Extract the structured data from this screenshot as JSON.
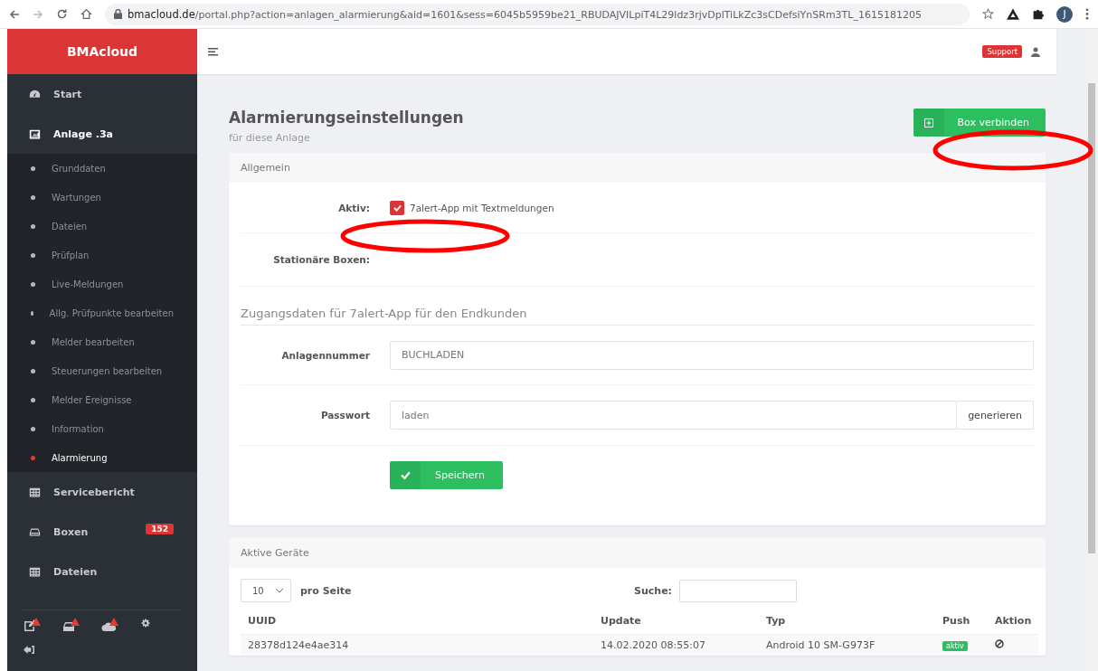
{
  "browser": {
    "domain": "bmacloud.de",
    "path": "/portal.php?action=anlagen_alarmierung&aid=1601&sess=6045b5959be21_RBUDAJVILpiT4L29ldz3rjvDplTiLkZc3sCDefsiYnSRm3TL_1615181205",
    "profile": "J"
  },
  "sidebar": {
    "brand": "BMAcloud",
    "items": [
      {
        "label": "Start",
        "selected": false
      },
      {
        "label": "Anlage .3a",
        "selected": true,
        "children": [
          {
            "label": "Grunddaten",
            "selected": false
          },
          {
            "label": "Wartungen",
            "selected": false
          },
          {
            "label": "Dateien",
            "selected": false
          },
          {
            "label": "Prüfplan",
            "selected": false
          },
          {
            "label": "Live-Meldungen",
            "selected": false
          },
          {
            "label": "Allg. Prüfpunkte bearbeiten",
            "selected": false
          },
          {
            "label": "Melder bearbeiten",
            "selected": false
          },
          {
            "label": "Steuerungen bearbeiten",
            "selected": false
          },
          {
            "label": "Melder Ereignisse",
            "selected": false
          },
          {
            "label": "Information",
            "selected": false
          },
          {
            "label": "Alarmierung",
            "selected": true
          }
        ]
      },
      {
        "label": "Servicebericht",
        "selected": false
      },
      {
        "label": "Boxen",
        "selected": false,
        "badge": "152"
      },
      {
        "label": "Dateien",
        "selected": false
      }
    ]
  },
  "header": {
    "support": "Support"
  },
  "page": {
    "title": "Alarmierungseinstellungen",
    "subtitle": "für diese Anlage",
    "connect_button": "Box verbinden"
  },
  "general": {
    "header": "Allgemein",
    "active_label": "Aktiv:",
    "active_option": "7alert-App mit Textmeldungen",
    "active_checked": true,
    "stationary_label": "Stationäre Boxen:",
    "section_title": "Zugangsdaten für 7alert-App für den Endkunden",
    "fields": [
      {
        "label": "Anlagennummer",
        "value": "BUCHLADEN"
      },
      {
        "label": "Passwort",
        "value": "laden",
        "button": "generieren"
      }
    ],
    "save_button": "Speichern"
  },
  "devices": {
    "header": "Aktive Geräte",
    "page_size": "10",
    "page_size_label": "pro Seite",
    "search_label": "Suche:",
    "columns": [
      "UUID",
      "Update",
      "Typ",
      "Push",
      "Aktion"
    ],
    "rows": [
      {
        "uuid": "28378d124e4ae314",
        "update": "14.02.2020 08:55:07",
        "type": "Android 10 SM-G973F",
        "push": "aktiv"
      }
    ]
  }
}
